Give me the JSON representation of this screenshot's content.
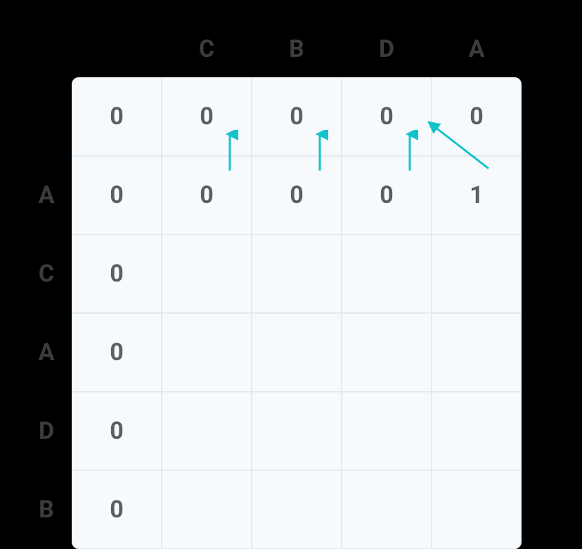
{
  "col_headers": [
    "C",
    "B",
    "D",
    "A"
  ],
  "row_labels": [
    "A",
    "C",
    "A",
    "D",
    "B"
  ],
  "cells": {
    "r0": [
      "0",
      "0",
      "0",
      "0",
      "0"
    ],
    "r1": [
      "0",
      "0",
      "0",
      "0",
      "1"
    ],
    "r2": [
      "0",
      "",
      "",
      "",
      ""
    ],
    "r3": [
      "0",
      "",
      "",
      "",
      ""
    ],
    "r4": [
      "0",
      "",
      "",
      "",
      ""
    ],
    "r5": [
      "0",
      "",
      "",
      "",
      ""
    ]
  },
  "arrows": [
    {
      "type": "up",
      "from_row": 1,
      "col": 1
    },
    {
      "type": "up",
      "from_row": 1,
      "col": 2
    },
    {
      "type": "up",
      "from_row": 1,
      "col": 3
    },
    {
      "type": "diag",
      "desc": "from approx row1/col4 toward row0/col3"
    }
  ],
  "arrow_color": "#12c3c9"
}
